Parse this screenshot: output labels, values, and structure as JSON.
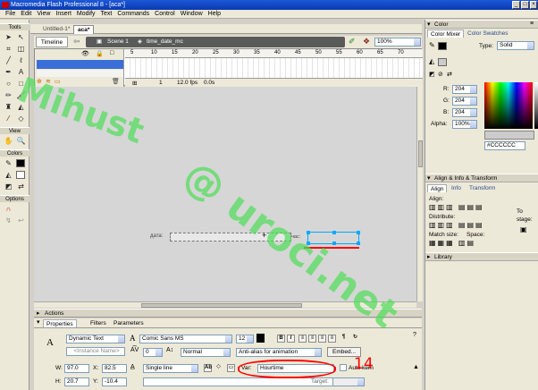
{
  "window": {
    "title": "Macromedia Flash Professional 8 - [аса*]"
  },
  "menu": [
    "File",
    "Edit",
    "View",
    "Insert",
    "Modify",
    "Text",
    "Commands",
    "Control",
    "Window",
    "Help"
  ],
  "tools": {
    "header": "Tools",
    "view_header": "View",
    "colors_header": "Colors",
    "options_header": "Options"
  },
  "doc_tabs": [
    "Untitled-1*",
    "аса*"
  ],
  "editbar": {
    "timeline_label": "Timeline",
    "scene": "Scene 1",
    "symbol": "time_date_mc",
    "zoom": "100%"
  },
  "timeline": {
    "ruler": [
      "5",
      "10",
      "15",
      "20",
      "25",
      "30",
      "35",
      "40",
      "45",
      "50",
      "55",
      "60",
      "65",
      "70"
    ],
    "frame": "1",
    "fps": "12.0 fps",
    "time": "0.0s"
  },
  "stage": {
    "label_left": "дата:",
    "label_right": "час:"
  },
  "panels": {
    "actions": "Actions",
    "tabs": [
      "Properties",
      "Filters",
      "Parameters"
    ]
  },
  "properties": {
    "text_type": "Dynamic Text",
    "instance_placeholder": "<Instance Name>",
    "font": "Comic Sans MS",
    "size": "12",
    "spacing": "0",
    "position": "Normal",
    "antialias": "Anti-alias for animation",
    "embed": "Embed...",
    "w_label": "W:",
    "w": "97.0",
    "x_label": "X:",
    "x": "82.5",
    "h_label": "H:",
    "h": "20.7",
    "y_label": "Y:",
    "y": "-10.4",
    "line_type": "Single line",
    "var_label": "Var:",
    "var": "Hourtime",
    "autokern": "Auto kern",
    "target_label": "Target:"
  },
  "color_panel": {
    "header": "Color",
    "tabs": [
      "Color Mixer",
      "Color Swatches"
    ],
    "type_label": "Type:",
    "type": "Solid",
    "r_label": "R:",
    "r": "204",
    "g_label": "G:",
    "g": "204",
    "b_label": "B:",
    "b": "204",
    "alpha_label": "Alpha:",
    "alpha": "100%",
    "hex": "#CCCCCC"
  },
  "align_panel": {
    "header": "Align & Info & Transform",
    "tabs": [
      "Align",
      "Info",
      "Transform"
    ],
    "align_label": "Align:",
    "distribute_label": "Distribute:",
    "match_label": "Match size:",
    "space_label": "Space:",
    "to_label": "To",
    "stage_label": "stage:"
  },
  "library_panel": {
    "header": "Library"
  },
  "annotation": {
    "text": "14"
  },
  "watermark": {
    "line1": "Mihust",
    "line2": "@ uroci.net"
  },
  "colors": {
    "title_bar": "#0a3ab0",
    "stage": "#d6d6d6",
    "annotation": "#ff0000",
    "watermark": "#50dc5a",
    "selection": "#00aaff"
  }
}
